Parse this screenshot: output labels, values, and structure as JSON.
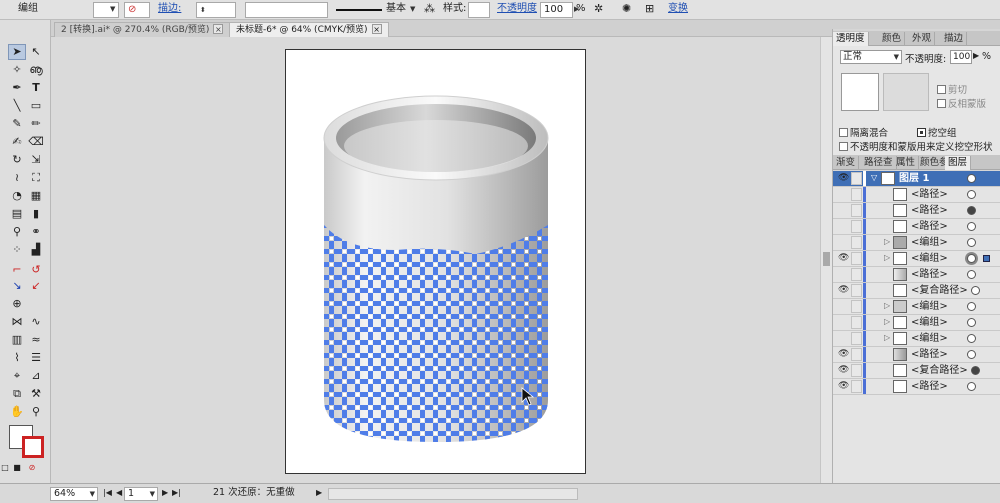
{
  "control_bar": {
    "object_type": "编组",
    "stroke_label": "描边:",
    "stroke_style": "基本",
    "style_label": "样式:",
    "opacity_label": "不透明度",
    "opacity_value": "100",
    "opacity_unit": "%",
    "transform_label": "变换"
  },
  "tabs": [
    {
      "label": "2 [转换].ai* @ 270.4% (RGB/预览)"
    },
    {
      "label": "未标题-6* @ 64% (CMYK/预览)"
    }
  ],
  "transparency_panel": {
    "tabs": [
      "透明度",
      "颜色",
      "外观",
      "描边"
    ],
    "blend_mode": "正常",
    "opacity_label": "不透明度:",
    "opacity_value": "100",
    "opacity_unit": "%",
    "clip": "剪切",
    "invert_mask": "反相蒙版",
    "isolate_blending": "隔离混合",
    "knockout_group": "挖空组",
    "opacity_mask_define": "不透明度和蒙版用来定义挖空形状"
  },
  "layers_panel": {
    "tabs": [
      "渐变",
      "路径查",
      "属性",
      "颜色参",
      "图层"
    ],
    "rows": [
      {
        "name": "图层 1"
      },
      {
        "name": "<路径>"
      },
      {
        "name": "<路径>"
      },
      {
        "name": "<路径>"
      },
      {
        "name": "<编组>"
      },
      {
        "name": "<编组>"
      },
      {
        "name": "<路径>"
      },
      {
        "name": "<复合路径>"
      },
      {
        "name": "<编组>"
      },
      {
        "name": "<编组>"
      },
      {
        "name": "<编组>"
      },
      {
        "name": "<路径>"
      },
      {
        "name": "<复合路径>"
      },
      {
        "name": "<路径>"
      }
    ]
  },
  "status_bar": {
    "zoom": "64%",
    "page": "1",
    "undo_info": "21 次还原：无重做"
  },
  "colors": {
    "accent": "#3f6fb6",
    "pattern": "#4f7de8"
  }
}
